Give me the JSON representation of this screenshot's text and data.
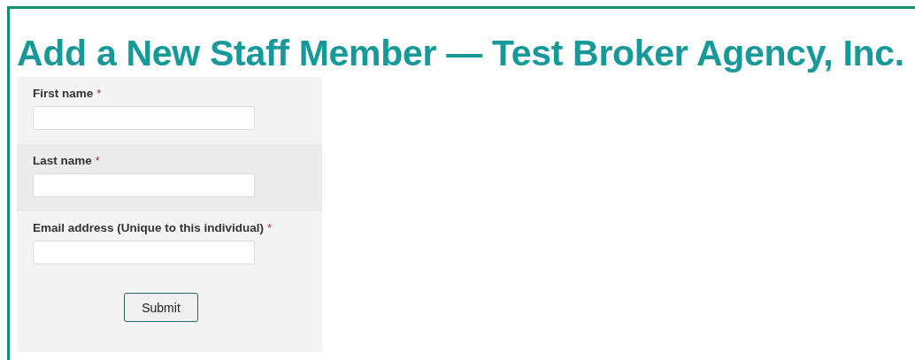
{
  "title": "Add a New Staff Member — Test Broker Agency, Inc.",
  "fields": [
    {
      "label": "First name",
      "required_mark": "*"
    },
    {
      "label": "Last name",
      "required_mark": "*"
    },
    {
      "label": "Email address (Unique to this individual)",
      "required_mark": "*"
    }
  ],
  "submit_button": "Submit"
}
